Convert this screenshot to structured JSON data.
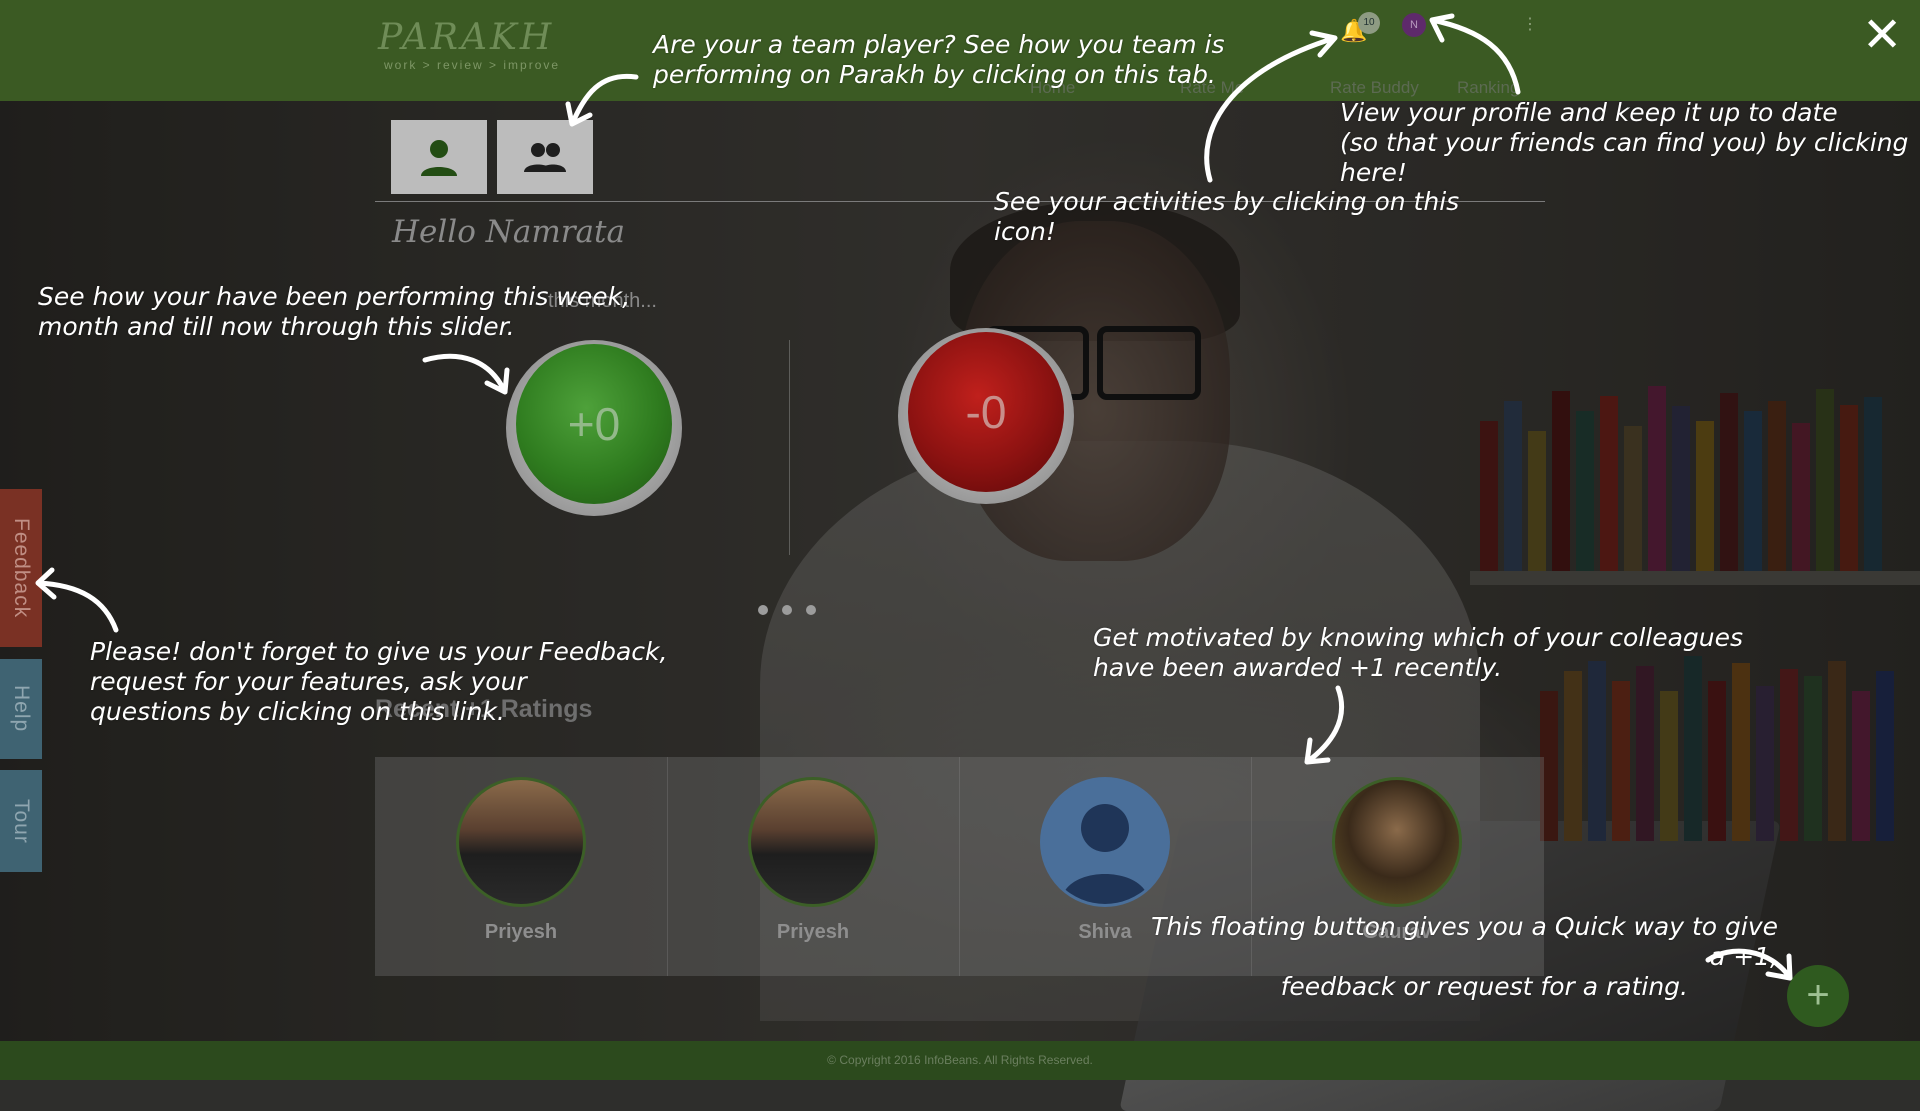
{
  "app": {
    "brand_name": "PARAKH",
    "brand_tagline": "work > review > improve",
    "notification_count": "10",
    "avatar_initial": "N",
    "close_label": "✕",
    "nav": [
      "Home",
      "Rate Me",
      "Rate Buddy",
      "Ranking"
    ]
  },
  "main": {
    "greeting": "Hello Namrata",
    "period_text": "this month...",
    "plus_value": "+0",
    "minus_value": "-0",
    "ratings_title": "Recent +1 Ratings",
    "recent_ratings": [
      {
        "name": "Priyesh"
      },
      {
        "name": "Priyesh"
      },
      {
        "name": "Shiva"
      },
      {
        "name": "Gaurav"
      }
    ],
    "fab_label": "+",
    "footer": "© Copyright 2016 InfoBeans. All Rights Reserved."
  },
  "side_tabs": {
    "feedback": "Feedback",
    "help": "Help",
    "tour": "Tour"
  },
  "annotations": {
    "team": [
      "Are your a team player? See how you team is",
      "performing on Parakh by clicking on this tab."
    ],
    "profile": [
      "View your profile and keep it up to date",
      "(so that your friends can find you) by clicking",
      "here!"
    ],
    "activities": [
      "See your activities by clicking on this",
      "icon!"
    ],
    "slider": [
      "See how your have been performing this week,",
      "month and till now through this slider."
    ],
    "feedback": [
      "Please! don't forget to give us your Feedback,",
      "request for your features, ask your",
      "questions by clicking on this link."
    ],
    "colleagues": [
      "Get motivated by knowing which of your colleagues",
      "have been awarded +1 recently."
    ],
    "fab": [
      "This floating button gives you a Quick way to give a +1,",
      "feedback or request for a rating."
    ]
  },
  "colors": {
    "header": "#3b5a23",
    "plus_button": "#2f7c1f",
    "minus_button": "#8c1211",
    "feedback_tab": "#7a3124",
    "help_tab": "#3f6372"
  },
  "icons": [
    "user-icon",
    "team-icon",
    "bell-icon",
    "close-icon",
    "kebab-icon",
    "plus-icon",
    "help-icon",
    "bike-icon",
    "feedback-icon"
  ]
}
